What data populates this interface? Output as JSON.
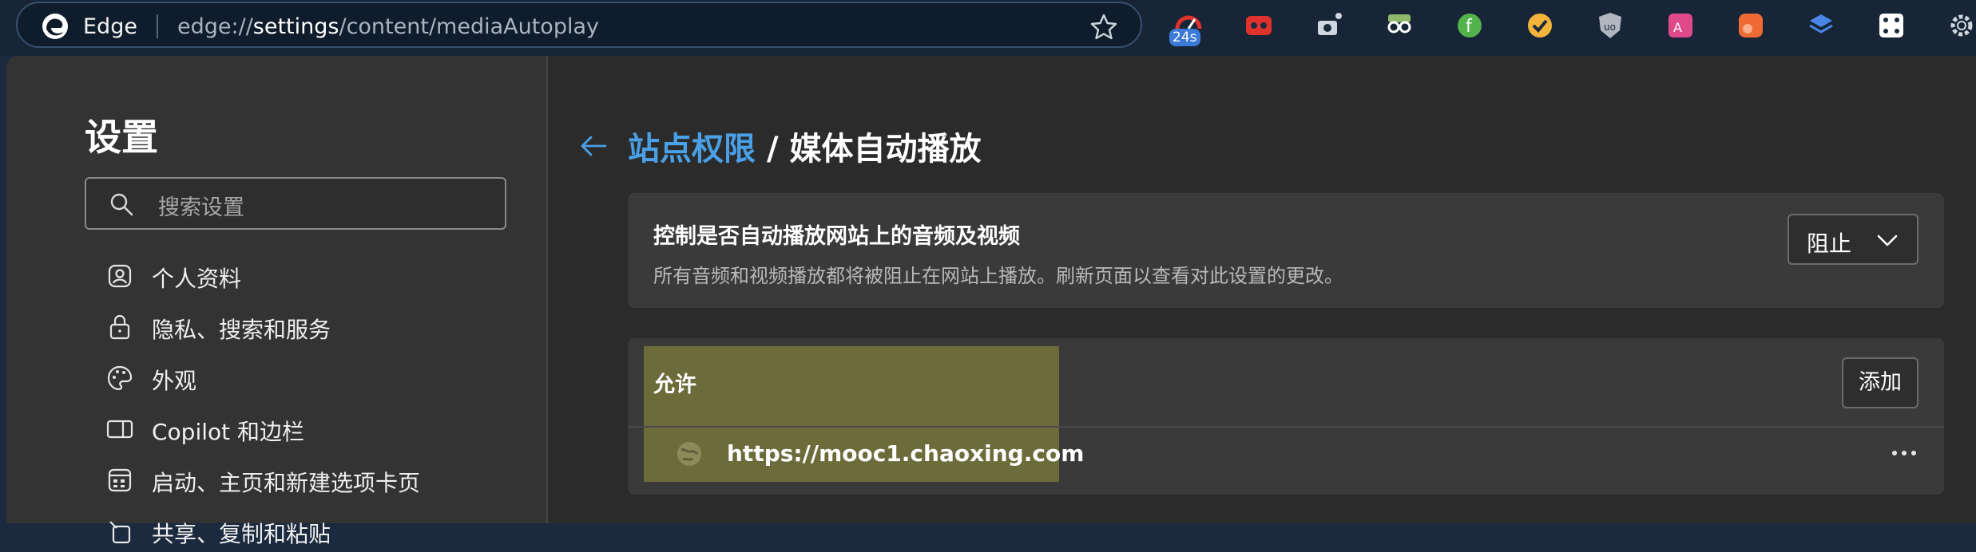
{
  "browser": {
    "brand": "Edge",
    "url_prefix": "edge://",
    "url_host": "settings",
    "url_path": "/content/mediaAutoplay",
    "extensions": [
      {
        "icon": "timer-extension-icon",
        "badge": "24s",
        "color": "#3b7ad9"
      },
      {
        "icon": "red-extension-icon",
        "color": "#e0322d"
      },
      {
        "icon": "camera-extension-icon",
        "color": "#cfd6e0"
      },
      {
        "icon": "spy-extension-icon",
        "color": "#8fb86b"
      },
      {
        "icon": "green-f-extension-icon",
        "color": "#52b24b"
      },
      {
        "icon": "yellow-check-extension-icon",
        "color": "#f2b43b"
      },
      {
        "icon": "ublock-extension-icon",
        "color": "#b0b7c0"
      },
      {
        "icon": "translate-extension-icon",
        "color": "#e04a8a"
      },
      {
        "icon": "orange-dots-extension-icon",
        "color": "#f06a35"
      },
      {
        "icon": "layers-extension-icon",
        "color": "#4a86e8"
      },
      {
        "icon": "dice-extension-icon",
        "color": "#ffffff"
      },
      {
        "icon": "gear-extension-icon",
        "color": "#d0d6dd"
      }
    ]
  },
  "sidebar": {
    "title": "设置",
    "search_placeholder": "搜索设置",
    "items": [
      {
        "label": "个人资料",
        "icon": "profile-icon"
      },
      {
        "label": "隐私、搜索和服务",
        "icon": "lock-icon"
      },
      {
        "label": "外观",
        "icon": "palette-icon"
      },
      {
        "label": "Copilot 和边栏",
        "icon": "sidebar-icon"
      },
      {
        "label": "启动、主页和新建选项卡页",
        "icon": "home-grid-icon"
      },
      {
        "label": "共享、复制和粘贴",
        "icon": "share-icon"
      }
    ]
  },
  "main": {
    "breadcrumb": {
      "parent": "站点权限",
      "separator": "/",
      "current": "媒体自动播放"
    },
    "autoplay_card": {
      "title": "控制是否自动播放网站上的音频及视频",
      "description": "所有音频和视频播放都将被阻止在网站上播放。刷新页面以查看对此设置的更改。",
      "dropdown_value": "阻止"
    },
    "allow_card": {
      "title": "允许",
      "add_label": "添加",
      "sites": [
        {
          "url": "https://mooc1.chaoxing.com"
        }
      ]
    }
  },
  "colors": {
    "accent": "#4aa0e6",
    "highlight": "#8a8a3a"
  }
}
